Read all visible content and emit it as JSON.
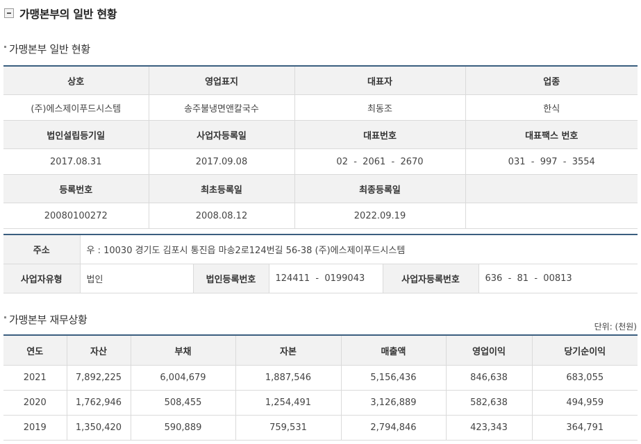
{
  "page": {
    "section_title": "가맹본부의 일반 현황"
  },
  "general": {
    "subtitle": "가맹본부 일반 현황",
    "rows": [
      {
        "headers": [
          "상호",
          "영업표지",
          "대표자",
          "업종"
        ],
        "values": [
          "(주)에스제이푸드시스템",
          "송주불냉면앤칼국수",
          "최동조",
          "한식"
        ]
      },
      {
        "headers": [
          "법인설립등기일",
          "사업자등록일",
          "대표번호",
          "대표팩스 번호"
        ],
        "values": [
          "2017.08.31",
          "2017.09.08",
          "02  -  2061  -  2670",
          "031  -  997  -  3554"
        ]
      },
      {
        "headers": [
          "등록번호",
          "최초등록일",
          "최종등록일",
          ""
        ],
        "values": [
          "20080100272",
          "2008.08.12",
          "2022.09.19",
          ""
        ]
      }
    ]
  },
  "address_block": {
    "address_label": "주소",
    "address_value": "우 : 10030 경기도 김포시 통진읍 마송2로124번길 56-38 (주)에스제이푸드시스템",
    "biz_type_label": "사업자유형",
    "biz_type_value": "법인",
    "corp_reg_label": "법인등록번호",
    "corp_reg_value": "124411  -  0199043",
    "biz_reg_label": "사업자등록번호",
    "biz_reg_value": "636  -  81  -  00813"
  },
  "finance": {
    "subtitle": "가맹본부 재무상황",
    "unit": "단위: (천원)",
    "headers": [
      "연도",
      "자산",
      "부채",
      "자본",
      "매출액",
      "영업이익",
      "당기순이익"
    ],
    "rows": [
      [
        "2021",
        "7,892,225",
        "6,004,679",
        "1,887,546",
        "5,156,436",
        "846,638",
        "683,055"
      ],
      [
        "2020",
        "1,762,946",
        "508,455",
        "1,254,491",
        "3,126,889",
        "582,638",
        "494,959"
      ],
      [
        "2019",
        "1,350,420",
        "590,889",
        "759,531",
        "2,794,846",
        "423,343",
        "364,791"
      ]
    ]
  }
}
